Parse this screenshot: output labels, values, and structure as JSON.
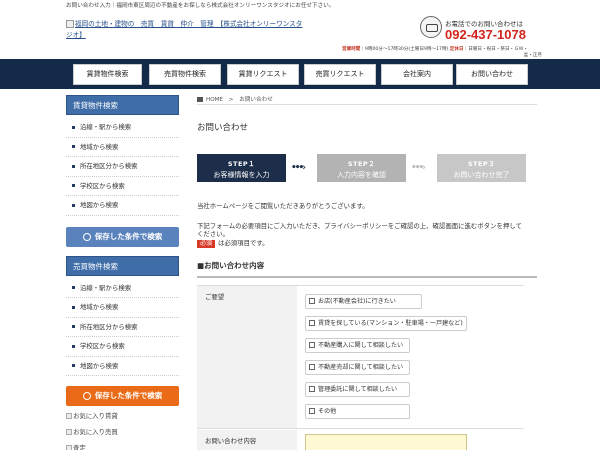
{
  "topbar": {
    "text": "お問い合わせ入力｜福岡市東区周辺の不動産をお探しなら株式会社オンリーワンスタジオにお任せ下さい。"
  },
  "header": {
    "logo_alt": "福岡の土地・建物の　売買　賃貸　仲介　管理　【株式会社オンリーワンスタジオ】",
    "phone_label": "お電話でのお問い合わせは",
    "phone_number": "092-437-1078",
    "hours_label": "営業時間",
    "hours_value": "｜9時00分～17時30分(土曜日9時～17時)",
    "holiday_label": "定休日",
    "holiday_value": "｜日曜日・祝日・祭日・ＧＷ・",
    "holiday_value2": "盆・正月",
    "brand_color": "#132a49",
    "phone_color": "#d2251c"
  },
  "nav": {
    "items": [
      {
        "label": "賃貸物件検索"
      },
      {
        "label": "売買物件検索"
      },
      {
        "label": "賃貸リクエスト"
      },
      {
        "label": "売買リクエスト"
      },
      {
        "label": "会社案内"
      },
      {
        "label": "お問い合わせ"
      }
    ]
  },
  "sidebar": {
    "rent_title": "賃貸物件検索",
    "rent_items": [
      {
        "label": "沿線・駅から検索"
      },
      {
        "label": "地域から検索"
      },
      {
        "label": "所在地区分から検索"
      },
      {
        "label": "学校区から検索"
      },
      {
        "label": "地図から検索"
      }
    ],
    "rent_saved": "保存した条件で検索",
    "sale_title": "売買物件検索",
    "sale_items": [
      {
        "label": "沿線・駅から検索"
      },
      {
        "label": "地域から検索"
      },
      {
        "label": "所在地区分から検索"
      },
      {
        "label": "学校区から検索"
      },
      {
        "label": "地図から検索"
      }
    ],
    "sale_saved": "保存した条件で検索",
    "fav_rent": "お気に入り賃貸",
    "fav_sale": "お気に入り売買",
    "fav_third": "査定"
  },
  "main": {
    "breadcrumb_home": "HOME",
    "breadcrumb_current": "お問い合わせ",
    "title": "お問い合わせ",
    "steps": [
      {
        "num": "STEP１",
        "label": "お客様情報を入力",
        "color": "#1c2e4a"
      },
      {
        "num": "STEP２",
        "label": "入力内容を確認",
        "color": "#b3b3b3"
      },
      {
        "num": "STEP３",
        "label": "お問い合わせ完了",
        "color": "#c7c7c7"
      }
    ],
    "intro1": "当社ホームページをご閲覧いただきありがとうございます。",
    "intro2": "下記フォームの必要項目にご入力いただき、プライバシーポリシーをご確認の上、確認画面に進むボタンを押してください。",
    "required_badge": "必須",
    "required_text": "は必須項目です。",
    "section_title": "■お問い合わせ内容"
  },
  "form": {
    "request_label": "ご要望",
    "options": [
      {
        "label": "お店(不動産会社)に行きたい"
      },
      {
        "label": "賃貸を探している(マンション・駐車場・一戸建など)"
      },
      {
        "label": "不動産購入に関して相談したい"
      },
      {
        "label": "不動産売却に関して相談したい"
      },
      {
        "label": "管理委託に関して相談したい"
      },
      {
        "label": "その他"
      }
    ],
    "content_label": "お問い合わせ内容"
  }
}
